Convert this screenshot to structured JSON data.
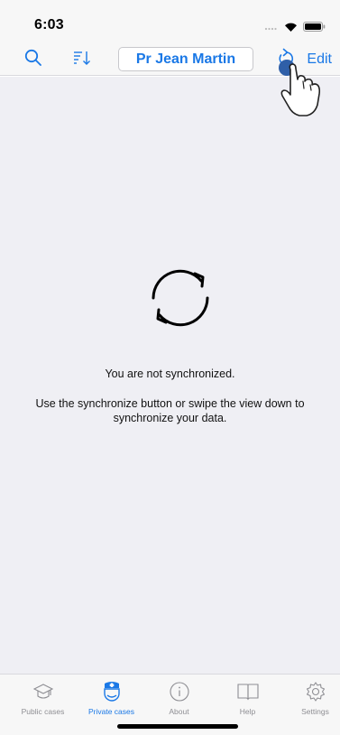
{
  "status_bar": {
    "time": "6:03",
    "icons": [
      "cellular-icon",
      "wifi-icon",
      "battery-icon"
    ]
  },
  "nav_bar": {
    "search_icon": "search-icon",
    "sort_icon": "sort-icon",
    "doctor_label": "Pr Jean Martin",
    "sync_icon": "refresh-icon",
    "edit_label": "Edit"
  },
  "content": {
    "icon": "sync-icon",
    "title": "You are not synchronized.",
    "message": "Use the synchronize button or swipe the view down to synchronize your data."
  },
  "tabs": [
    {
      "label": "Public cases",
      "icon": "graduation-cap-icon",
      "active": false
    },
    {
      "label": "Private cases",
      "icon": "doctor-icon",
      "active": true
    },
    {
      "label": "About",
      "icon": "info-icon",
      "active": false
    },
    {
      "label": "Help",
      "icon": "book-icon",
      "active": false
    },
    {
      "label": "Settings",
      "icon": "gear-icon",
      "active": false
    }
  ],
  "colors": {
    "accent": "#1a78e6",
    "inactive": "#8e8e93",
    "background": "#efeff4",
    "bar": "#f7f7f7"
  }
}
